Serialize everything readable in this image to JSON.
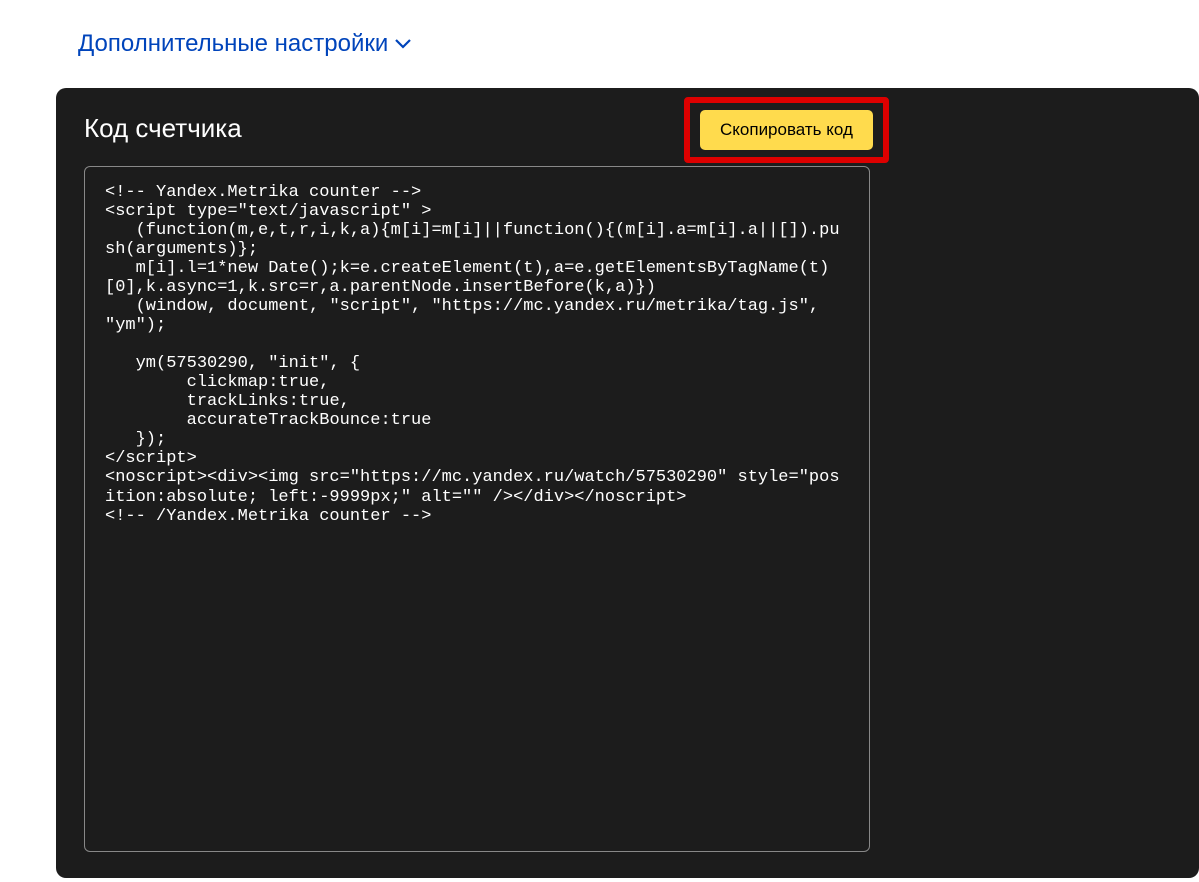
{
  "additional_settings_label": "Дополнительные настройки",
  "counter_code_title": "Код счетчика",
  "copy_button_label": "Скопировать код",
  "counter_code_content": "<!-- Yandex.Metrika counter -->\n<script type=\"text/javascript\" >\n   (function(m,e,t,r,i,k,a){m[i]=m[i]||function(){(m[i].a=m[i].a||[]).push(arguments)};\n   m[i].l=1*new Date();k=e.createElement(t),a=e.getElementsByTagName(t)[0],k.async=1,k.src=r,a.parentNode.insertBefore(k,a)})\n   (window, document, \"script\", \"https://mc.yandex.ru/metrika/tag.js\", \"ym\");\n\n   ym(57530290, \"init\", {\n        clickmap:true,\n        trackLinks:true,\n        accurateTrackBounce:true\n   });\n</script>\n<noscript><div><img src=\"https://mc.yandex.ru/watch/57530290\" style=\"position:absolute; left:-9999px;\" alt=\"\" /></div></noscript>\n<!-- /Yandex.Metrika counter -->"
}
